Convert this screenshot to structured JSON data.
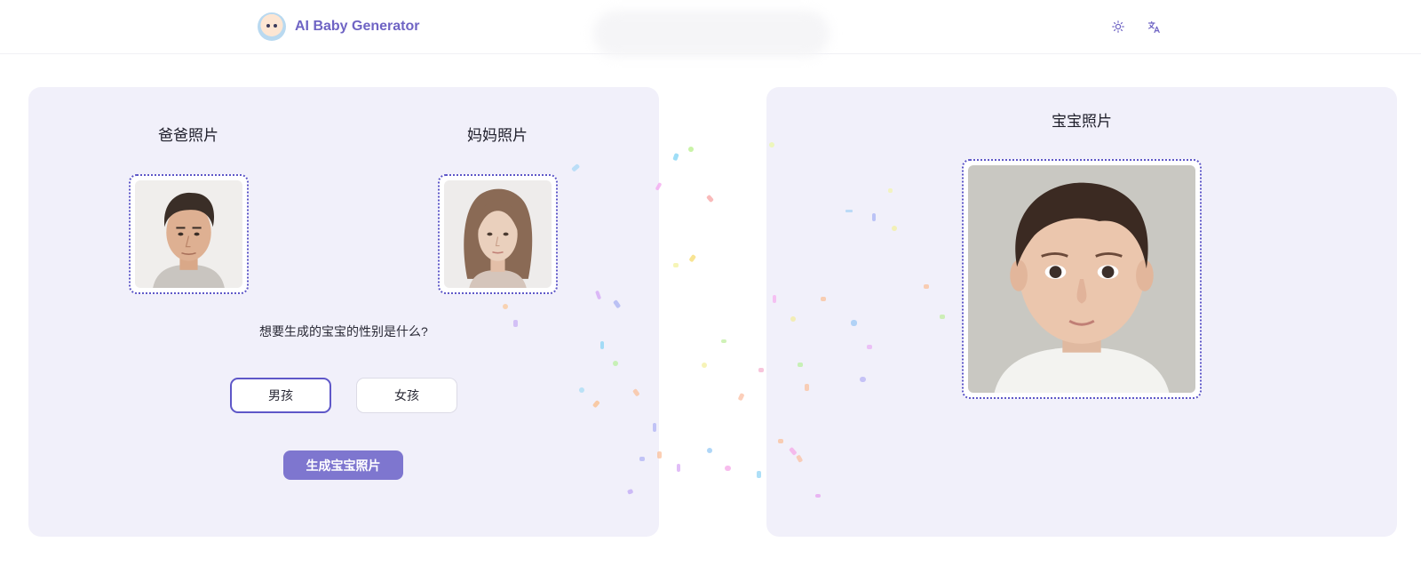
{
  "header": {
    "app_name": "AI Baby Generator",
    "logo_icon": "baby-face-logo",
    "theme_icon": "sun-icon",
    "language_icon": "translate-icon"
  },
  "left_panel": {
    "father_title": "爸爸照片",
    "mother_title": "妈妈照片",
    "gender_question": "想要生成的宝宝的性别是什么?",
    "boy_label": "男孩",
    "girl_label": "女孩",
    "selected_gender": "男孩",
    "generate_label": "生成宝宝照片"
  },
  "right_panel": {
    "baby_title": "宝宝照片"
  },
  "colors": {
    "accent": "#5e57c8",
    "button": "#7e76cf",
    "panel_bg": "#f1f0fa"
  }
}
